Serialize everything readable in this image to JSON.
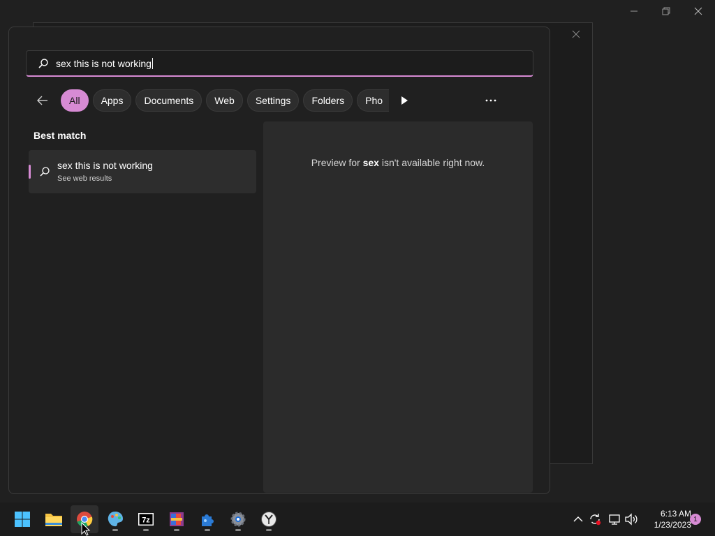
{
  "search": {
    "query": "sex this is not working"
  },
  "filters": {
    "items": [
      {
        "label": "All",
        "active": true
      },
      {
        "label": "Apps"
      },
      {
        "label": "Documents"
      },
      {
        "label": "Web"
      },
      {
        "label": "Settings"
      },
      {
        "label": "Folders"
      },
      {
        "label": "Pho"
      }
    ]
  },
  "results": {
    "section_label": "Best match",
    "best_match": {
      "title": "sex this is not working",
      "subtitle": "See web results"
    }
  },
  "preview": {
    "prefix": "Preview for ",
    "term": "sex",
    "suffix": " isn't available right now."
  },
  "taskbar": {
    "apps": [
      {
        "name": "start",
        "icon": "windows-logo-icon"
      },
      {
        "name": "file-explorer",
        "icon": "folder-icon"
      },
      {
        "name": "chrome",
        "icon": "chrome-icon"
      },
      {
        "name": "paint",
        "icon": "palette-icon"
      },
      {
        "name": "7zip",
        "icon": "7z-icon"
      },
      {
        "name": "winrar",
        "icon": "archive-icon"
      },
      {
        "name": "app-blue",
        "icon": "puzzle-icon"
      },
      {
        "name": "settings",
        "icon": "gear-icon"
      },
      {
        "name": "clock-app",
        "icon": "clock-icon"
      }
    ],
    "time": "6:13 AM",
    "date": "1/23/2023",
    "notification_count": "1"
  },
  "colors": {
    "accent": "#d78bd4",
    "background": "#202020",
    "card": "#2d2d2d"
  }
}
